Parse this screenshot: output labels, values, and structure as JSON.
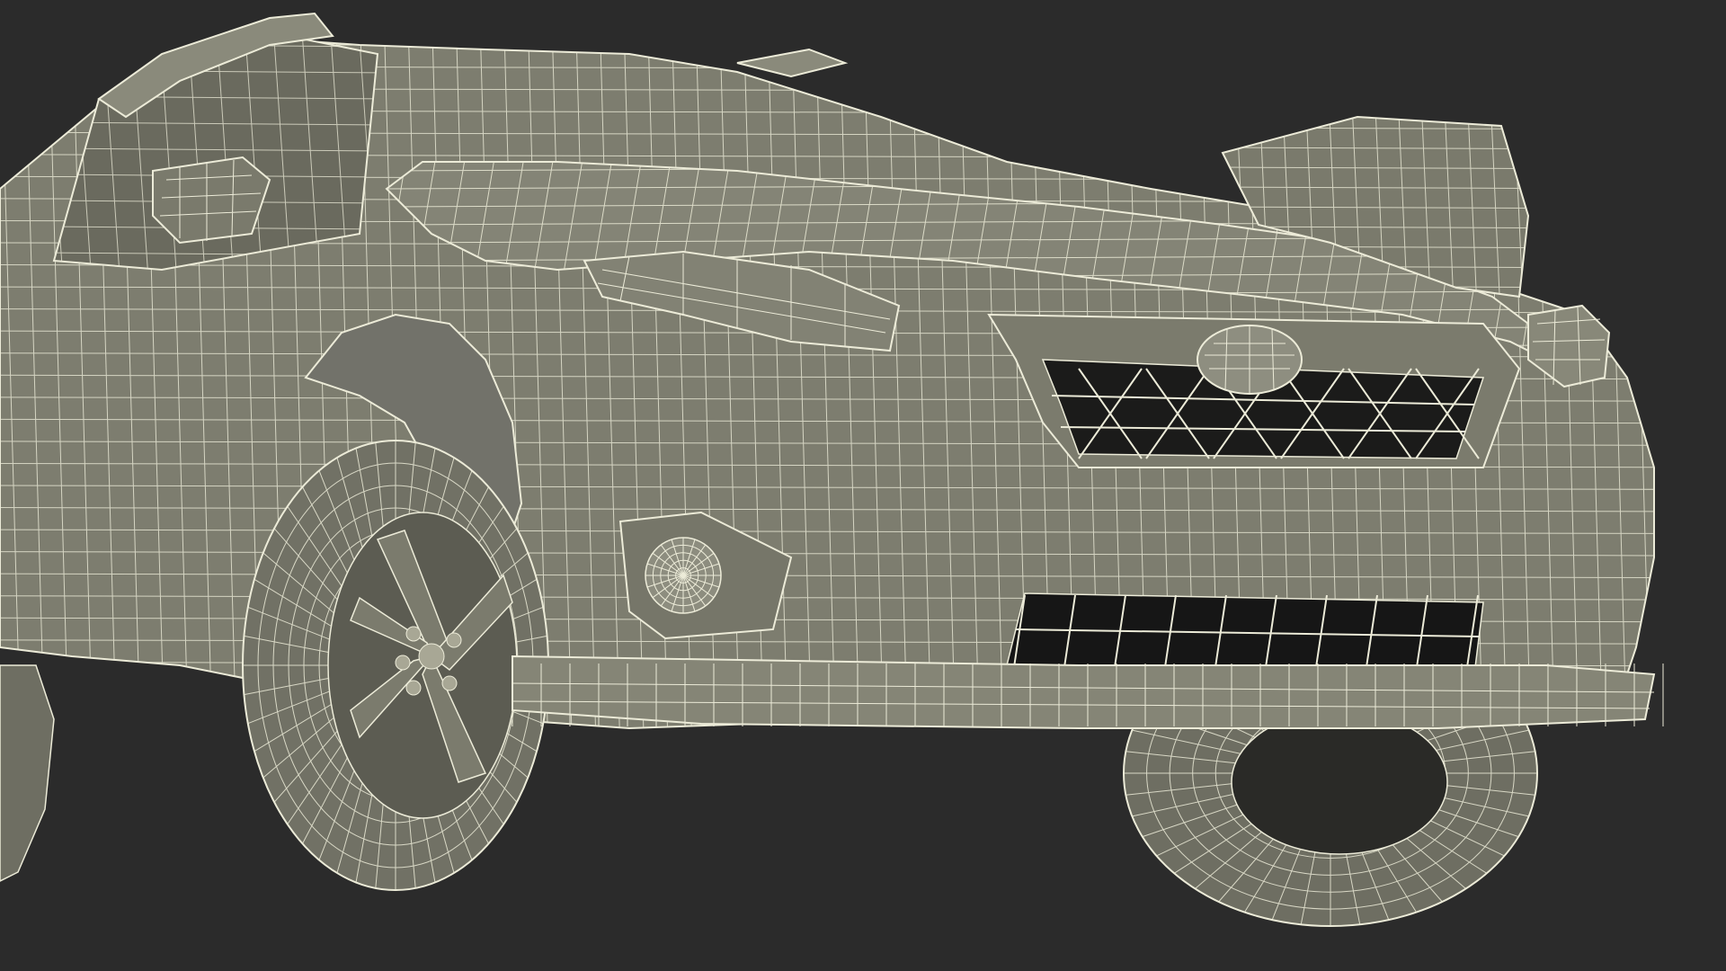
{
  "scene": {
    "subject": "wireframe-car-front-three-quarter",
    "colors": {
      "background": "#2b2b2b",
      "surface": "#7d7d6f",
      "surface_dark": "#5e5e53",
      "surface_shadow": "#4a4a42",
      "wire": "#ecebd8",
      "cavity": "#161616"
    },
    "icons": [
      "subaru-oval-emblem"
    ]
  }
}
